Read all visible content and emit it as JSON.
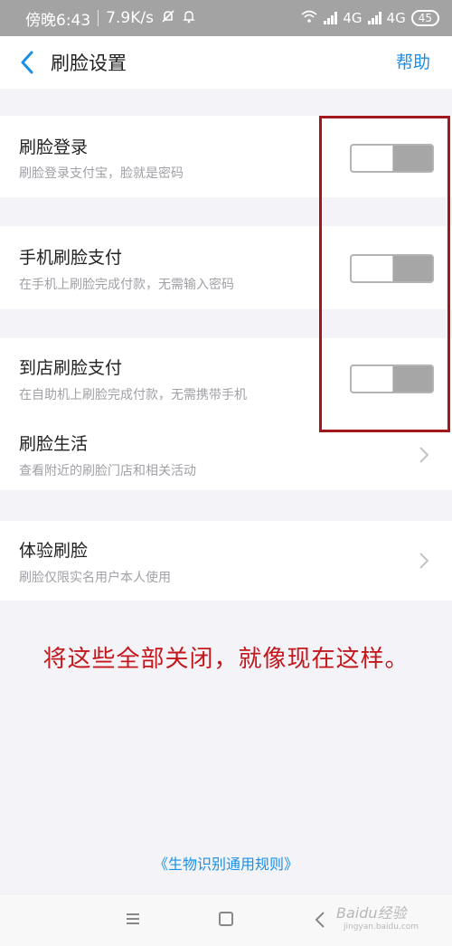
{
  "status_bar": {
    "time": "傍晚6:43",
    "speed": "7.9K/s",
    "network1": "4G",
    "network2": "4G",
    "battery": "45"
  },
  "header": {
    "title": "刷脸设置",
    "help": "帮助"
  },
  "settings": [
    {
      "title": "刷脸登录",
      "subtitle": "刷脸登录支付宝，脸就是密码",
      "toggle": false
    },
    {
      "title": "手机刷脸支付",
      "subtitle": "在手机上刷脸完成付款，无需输入密码",
      "toggle": false
    },
    {
      "title": "到店刷脸支付",
      "subtitle": "在自助机上刷脸完成付款，无需携带手机",
      "toggle": false
    }
  ],
  "links": [
    {
      "title": "刷脸生活",
      "subtitle": "查看附近的刷脸门店和相关活动"
    },
    {
      "title": "体验刷脸",
      "subtitle": "刷脸仅限实名用户本人使用"
    }
  ],
  "annotation": "将这些全部关闭，就像现在这样。",
  "rules_link": "《生物识别通用规则》",
  "watermark": {
    "logo": "Baidu经验",
    "sub": "jingyan.baidu.com"
  },
  "colors": {
    "accent": "#1a8fe6",
    "annotation": "#c3171c",
    "toggle_off": "#a6a6a6"
  }
}
